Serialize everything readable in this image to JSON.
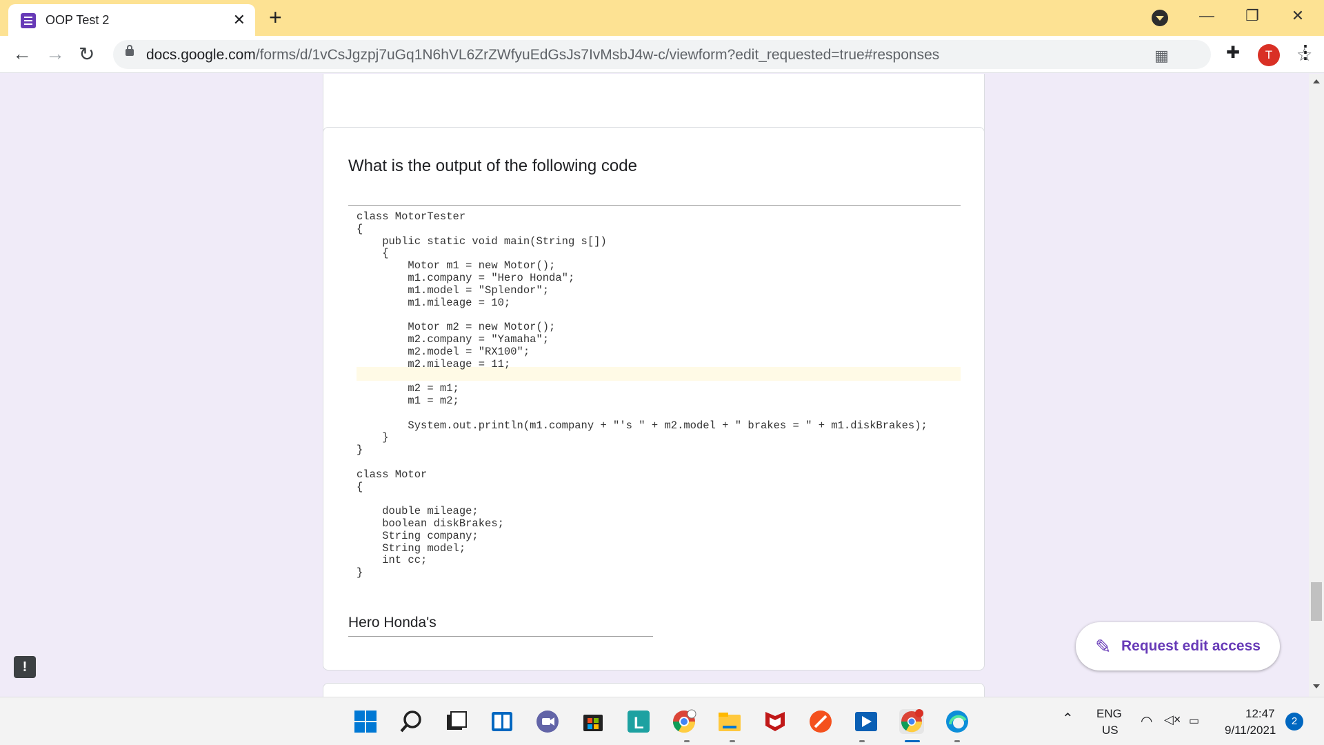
{
  "browser": {
    "tab_title": "OOP Test 2",
    "tab_close": "✕",
    "new_tab": "+",
    "url_host": "docs.google.com",
    "url_path": "/forms/d/1vCsJgzpj7uGq1N6hVL6ZrZWfyuEdGsJs7IvMsbJ4w-c/viewform?edit_requested=true#responses",
    "profile_initial": "T",
    "window_controls": {
      "minimize": "—",
      "restore": "❐",
      "close": "✕"
    }
  },
  "form": {
    "question": "What is the output of the following code",
    "code_lines": [
      "class MotorTester",
      "{",
      "    public static void main(String s[])",
      "    {",
      "        Motor m1 = new Motor();",
      "        m1.company = \"Hero Honda\";",
      "        m1.model = \"Splendor\";",
      "        m1.mileage = 10;",
      "",
      "        Motor m2 = new Motor();",
      "        m2.company = \"Yamaha\";",
      "        m2.model = \"RX100\";",
      "        m2.mileage = 11;",
      "",
      "        m2 = m1;",
      "        m1 = m2;",
      "",
      "        System.out.println(m1.company + \"'s \" + m2.model + \" brakes = \" + m1.diskBrakes);",
      "    }",
      "}",
      "",
      "class Motor",
      "{",
      "",
      "    double mileage;",
      "    boolean diskBrakes;",
      "    String company;",
      "    String model;",
      "    int cc;",
      "}"
    ],
    "answer": "Hero Honda's",
    "edit_button": "Request edit access",
    "report_icon": "!"
  },
  "taskbar": {
    "lang_top": "ENG",
    "lang_bottom": "US",
    "time": "12:47",
    "date": "9/11/2021",
    "notification_count": "2"
  },
  "colors": {
    "accent": "#673ab7",
    "page_bg": "#f0ebf8",
    "titlebar": "#fde293"
  }
}
